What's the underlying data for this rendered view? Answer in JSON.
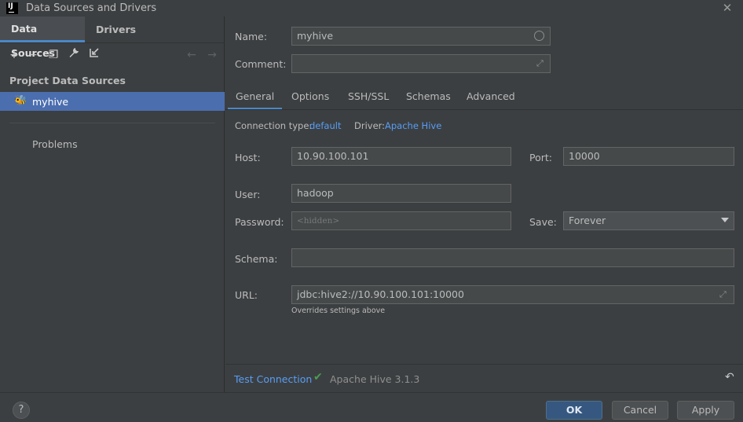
{
  "window": {
    "title": "Data Sources and Drivers"
  },
  "left": {
    "tabs": [
      "Data Sources",
      "Drivers"
    ],
    "section_title": "Project Data Sources",
    "items": [
      {
        "label": "myhive"
      }
    ],
    "problems_label": "Problems",
    "toolbar_icons": [
      "add-icon",
      "remove-icon",
      "duplicate-icon",
      "wrench-icon",
      "import-icon",
      "back-arrow-icon",
      "forward-arrow-icon"
    ]
  },
  "form": {
    "name_label": "Name:",
    "name_value": "myhive",
    "comment_label": "Comment:",
    "comment_value": "",
    "tabs": [
      "General",
      "Options",
      "SSH/SSL",
      "Schemas",
      "Advanced"
    ],
    "connection_type_label": "Connection type:",
    "connection_type_value": "default",
    "driver_label": "Driver:",
    "driver_value": "Apache Hive",
    "host_label": "Host:",
    "host_value": "10.90.100.101",
    "port_label": "Port:",
    "port_value": "10000",
    "user_label": "User:",
    "user_value": "hadoop",
    "password_label": "Password:",
    "password_value": "<hidden>",
    "save_label": "Save:",
    "save_value": "Forever",
    "schema_label": "Schema:",
    "schema_value": "",
    "url_label": "URL:",
    "url_value": "jdbc:hive2://10.90.100.101:10000",
    "url_hint": "Overrides settings above"
  },
  "status": {
    "test_connection": "Test Connection",
    "driver_version": "Apache Hive 3.1.3",
    "success_color": "#499c54"
  },
  "buttons": {
    "ok": "OK",
    "cancel": "Cancel",
    "apply": "Apply",
    "help": "?"
  },
  "colors": {
    "accent": "#4a88c7",
    "selection": "#4b6eaf",
    "link": "#589df6"
  }
}
